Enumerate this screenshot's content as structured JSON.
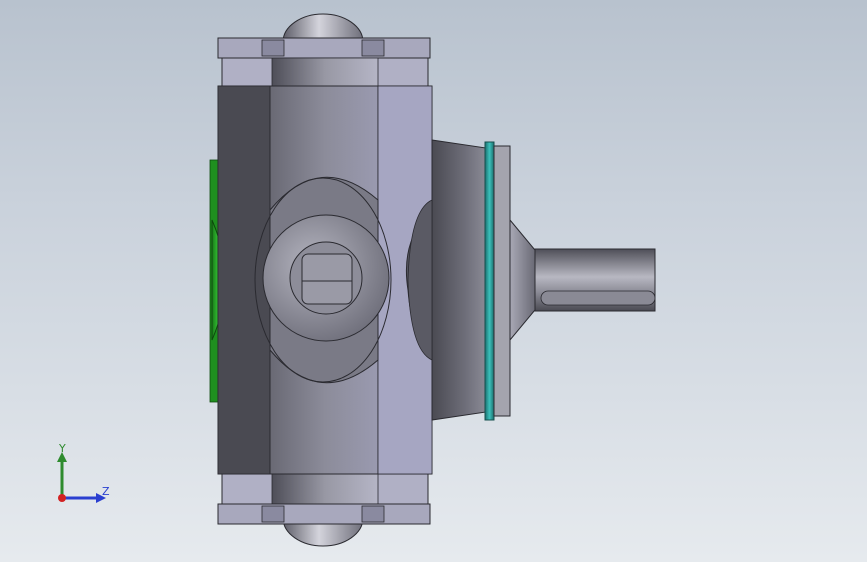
{
  "viewport": {
    "background_top": "#b8c2ce",
    "background_bottom": "#e6eaee"
  },
  "model": {
    "name": "gear-pump-assembly",
    "body_color": "#8e8ea0",
    "seal_color": "#2a9d9a",
    "gear_color": "#22b022",
    "shaft_color": "#6c6c74"
  },
  "triad": {
    "y_label": "Y",
    "z_label": "Z",
    "y_color": "#2e8b2e",
    "z_color": "#2a3fd0",
    "x_color": "#d22222"
  }
}
